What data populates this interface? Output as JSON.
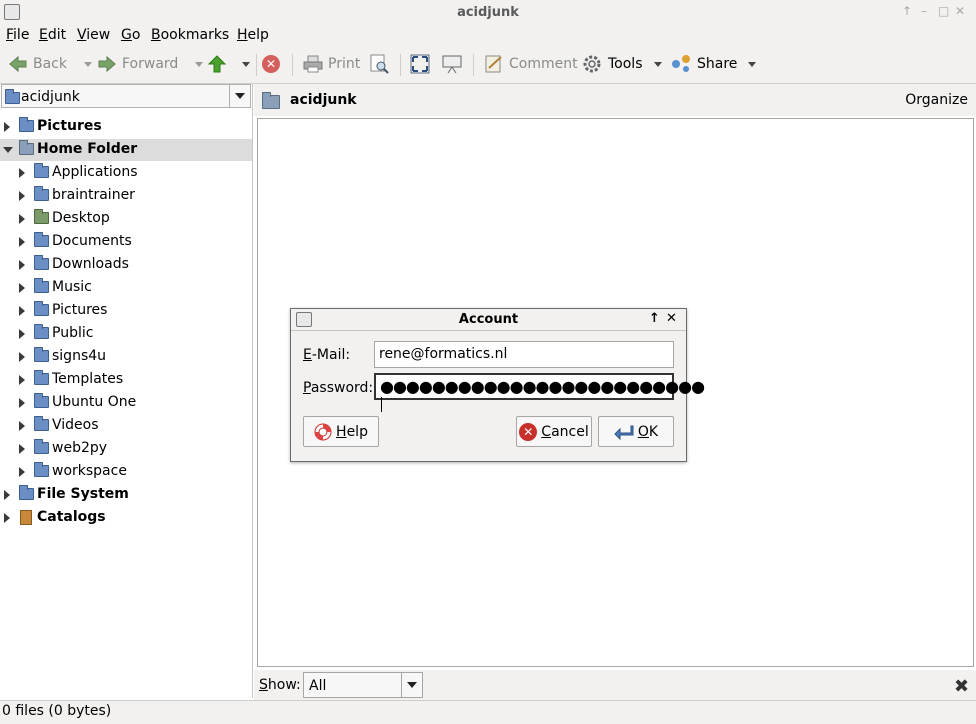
{
  "window": {
    "title": "acidjunk"
  },
  "menubar": {
    "items": [
      {
        "label": "File",
        "accel": "F",
        "rest": "ile"
      },
      {
        "label": "Edit",
        "accel": "E",
        "rest": "dit"
      },
      {
        "label": "View",
        "accel": "V",
        "rest": "iew"
      },
      {
        "label": "Go",
        "accel": "G",
        "rest": "o"
      },
      {
        "label": "Bookmarks",
        "accel": "B",
        "rest": "ookmarks"
      },
      {
        "label": "Help",
        "accel": "H",
        "rest": "elp"
      }
    ]
  },
  "toolbar": {
    "back": "Back",
    "forward": "Forward",
    "print": "Print",
    "comment": "Comment",
    "tools": "Tools",
    "share": "Share"
  },
  "sidebar": {
    "location": "acidjunk",
    "tree": [
      {
        "label": "Pictures",
        "level": 0,
        "bold": true,
        "expanded": false,
        "icon": "folder-icon"
      },
      {
        "label": "Home Folder",
        "level": 0,
        "bold": true,
        "expanded": true,
        "selected": true,
        "icon": "home-folder-icon"
      },
      {
        "label": "Applications",
        "level": 1,
        "icon": "folder-icon"
      },
      {
        "label": "braintrainer",
        "level": 1,
        "icon": "folder-icon"
      },
      {
        "label": "Desktop",
        "level": 1,
        "icon": "desktop-icon"
      },
      {
        "label": "Documents",
        "level": 1,
        "icon": "folder-icon"
      },
      {
        "label": "Downloads",
        "level": 1,
        "icon": "folder-icon"
      },
      {
        "label": "Music",
        "level": 1,
        "icon": "folder-icon"
      },
      {
        "label": "Pictures",
        "level": 1,
        "icon": "folder-icon"
      },
      {
        "label": "Public",
        "level": 1,
        "icon": "folder-icon"
      },
      {
        "label": "signs4u",
        "level": 1,
        "icon": "folder-icon"
      },
      {
        "label": "Templates",
        "level": 1,
        "icon": "folder-icon"
      },
      {
        "label": "Ubuntu One",
        "level": 1,
        "icon": "folder-icon"
      },
      {
        "label": "Videos",
        "level": 1,
        "icon": "folder-icon"
      },
      {
        "label": "web2py",
        "level": 1,
        "icon": "folder-icon"
      },
      {
        "label": "workspace",
        "level": 1,
        "icon": "folder-icon"
      },
      {
        "label": "File System",
        "level": 0,
        "bold": true,
        "expanded": false,
        "icon": "folder-icon"
      },
      {
        "label": "Catalogs",
        "level": 0,
        "bold": true,
        "expanded": false,
        "icon": "catalog-icon"
      }
    ]
  },
  "main": {
    "title": "acidjunk",
    "organize": "Organize",
    "show_label": "Show:",
    "show_value": "All"
  },
  "status": {
    "text": "0 files (0 bytes)"
  },
  "dialog": {
    "title": "Account",
    "email_label_accel": "E",
    "email_label_rest": "-Mail:",
    "email_value": "rene@formatics.nl",
    "password_label_accel": "P",
    "password_label_rest": "assword:",
    "password_dots": "●●●●●●●●●●●●●●●●●●●●●●●●●",
    "help_accel": "H",
    "help_rest": "elp",
    "cancel_accel": "C",
    "cancel_rest": "ancel",
    "ok_accel": "O",
    "ok_rest": "K"
  },
  "colors": {
    "accent_folder": "#6b8fc4",
    "stop_red": "#c9302c",
    "up_green": "#4aa02c"
  }
}
